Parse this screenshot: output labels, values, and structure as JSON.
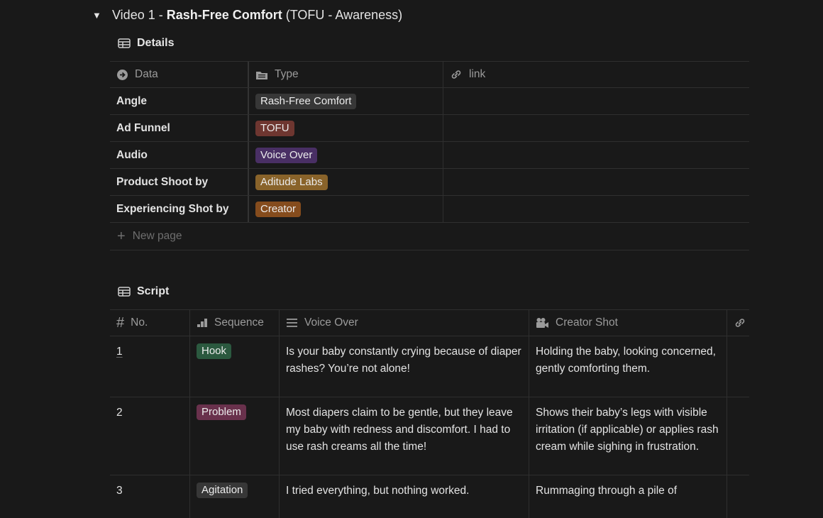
{
  "toggle": {
    "title_prefix": "Video 1 - ",
    "title_bold": "Rash-Free Comfort",
    "title_suffix": " (TOFU - Awareness)"
  },
  "details": {
    "title": "Details",
    "headers": [
      "Data",
      "Type",
      "link"
    ],
    "rows": [
      {
        "label": "Angle",
        "tag": "Rash-Free Comfort",
        "tag_color": "#373737"
      },
      {
        "label": "Ad Funnel",
        "tag": "TOFU",
        "tag_color": "#6e3630"
      },
      {
        "label": "Audio",
        "tag": "Voice Over",
        "tag_color": "#492f64"
      },
      {
        "label": "Product Shoot by",
        "tag": "Aditude Labs",
        "tag_color": "#89632a"
      },
      {
        "label": "Experiencing Shot by",
        "tag": "Creator",
        "tag_color": "#854c1d"
      }
    ],
    "new_page": "New page"
  },
  "script": {
    "title": "Script",
    "headers": [
      "No.",
      "Sequence",
      "Voice Over",
      "Creator Shot"
    ],
    "rows": [
      {
        "no": "1",
        "sequence": "Hook",
        "seq_color": "#2b593f",
        "voice_over": "Is your baby constantly crying because of diaper rashes? You’re not alone!",
        "creator_shot": "Holding the baby, looking concerned, gently comforting them."
      },
      {
        "no": "2",
        "sequence": "Problem",
        "seq_color": "#69314c",
        "voice_over": "Most diapers claim to be gentle, but they leave my baby with redness and discomfort. I had to use rash creams all the time!",
        "creator_shot": "Shows their baby’s legs with visible irritation (if applicable) or applies rash cream while sighing in frustration."
      },
      {
        "no": "3",
        "sequence": "Agitation",
        "seq_color": "#373737",
        "voice_over": "I tried everything, but nothing worked.",
        "creator_shot": "Rummaging through a pile of"
      }
    ]
  }
}
